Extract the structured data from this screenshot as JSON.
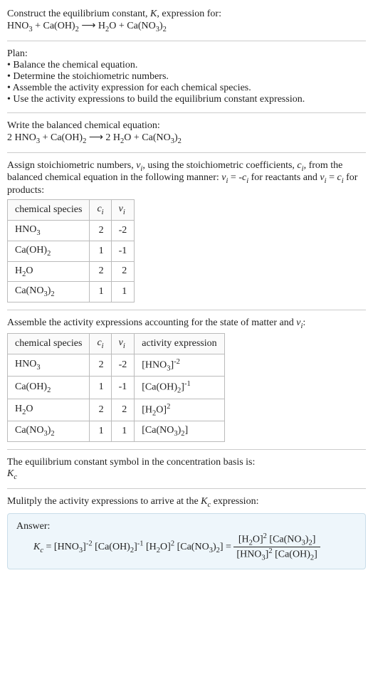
{
  "intro": {
    "line1": "Construct the equilibrium constant, K, expression for:",
    "equation": "HNO₃ + Ca(OH)₂ ⟶ H₂O + Ca(NO₃)₂"
  },
  "plan": {
    "heading": "Plan:",
    "items": [
      "Balance the chemical equation.",
      "Determine the stoichiometric numbers.",
      "Assemble the activity expression for each chemical species.",
      "Use the activity expressions to build the equilibrium constant expression."
    ]
  },
  "balanced": {
    "heading": "Write the balanced chemical equation:",
    "equation": "2 HNO₃ + Ca(OH)₂ ⟶ 2 H₂O + Ca(NO₃)₂"
  },
  "stoich": {
    "intro_a": "Assign stoichiometric numbers, νᵢ, using the stoichiometric coefficients, cᵢ, from the balanced chemical equation in the following manner: νᵢ = -cᵢ for reactants and νᵢ = cᵢ for products:",
    "headers": [
      "chemical species",
      "cᵢ",
      "νᵢ"
    ],
    "rows": [
      {
        "species": "HNO₃",
        "c": "2",
        "v": "-2"
      },
      {
        "species": "Ca(OH)₂",
        "c": "1",
        "v": "-1"
      },
      {
        "species": "H₂O",
        "c": "2",
        "v": "2"
      },
      {
        "species": "Ca(NO₃)₂",
        "c": "1",
        "v": "1"
      }
    ]
  },
  "activity": {
    "intro": "Assemble the activity expressions accounting for the state of matter and νᵢ:",
    "headers": [
      "chemical species",
      "cᵢ",
      "νᵢ",
      "activity expression"
    ],
    "rows": [
      {
        "species": "HNO₃",
        "c": "2",
        "v": "-2",
        "expr": "[HNO₃]⁻²"
      },
      {
        "species": "Ca(OH)₂",
        "c": "1",
        "v": "-1",
        "expr": "[Ca(OH)₂]⁻¹"
      },
      {
        "species": "H₂O",
        "c": "2",
        "v": "2",
        "expr": "[H₂O]²"
      },
      {
        "species": "Ca(NO₃)₂",
        "c": "1",
        "v": "1",
        "expr": "[Ca(NO₃)₂]"
      }
    ]
  },
  "symbol": {
    "text": "The equilibrium constant symbol in the concentration basis is:",
    "sym": "K_c"
  },
  "final": {
    "intro": "Mulitply the activity expressions to arrive at the K_c expression:",
    "answer_label": "Answer:",
    "lhs": "K_c = [HNO₃]⁻² [Ca(OH)₂]⁻¹ [H₂O]² [Ca(NO₃)₂] =",
    "frac_num": "[H₂O]² [Ca(NO₃)₂]",
    "frac_den": "[HNO₃]² [Ca(OH)₂]"
  },
  "chart_data": {
    "type": "table",
    "tables": [
      {
        "title": "Stoichiometric numbers",
        "columns": [
          "chemical species",
          "c_i",
          "ν_i"
        ],
        "rows": [
          [
            "HNO3",
            2,
            -2
          ],
          [
            "Ca(OH)2",
            1,
            -1
          ],
          [
            "H2O",
            2,
            2
          ],
          [
            "Ca(NO3)2",
            1,
            1
          ]
        ]
      },
      {
        "title": "Activity expressions",
        "columns": [
          "chemical species",
          "c_i",
          "ν_i",
          "activity expression"
        ],
        "rows": [
          [
            "HNO3",
            2,
            -2,
            "[HNO3]^-2"
          ],
          [
            "Ca(OH)2",
            1,
            -1,
            "[Ca(OH)2]^-1"
          ],
          [
            "H2O",
            2,
            2,
            "[H2O]^2"
          ],
          [
            "Ca(NO3)2",
            1,
            1,
            "[Ca(NO3)2]"
          ]
        ]
      }
    ]
  }
}
